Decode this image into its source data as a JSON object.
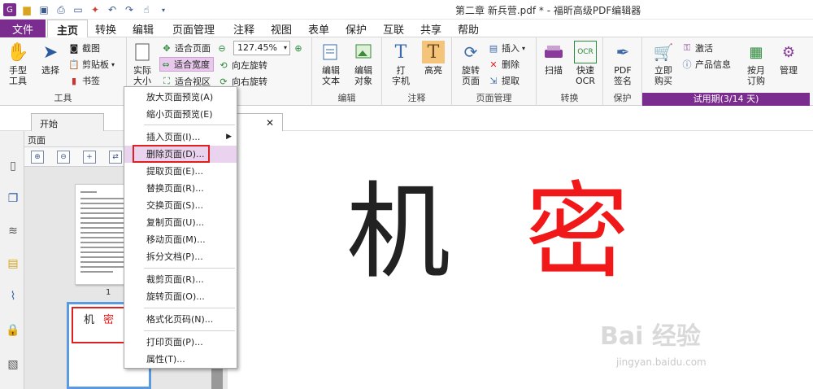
{
  "title": "第二章 新兵营.pdf * - 福昕高级PDF编辑器",
  "menu_tabs": [
    "文件",
    "主页",
    "转换",
    "编辑",
    "页面管理",
    "注释",
    "视图",
    "表单",
    "保护",
    "互联",
    "共享",
    "帮助"
  ],
  "ribbon": {
    "hand_tool": "手型\n工具",
    "select": "选择",
    "screenshot": "截图",
    "clipboard": "剪贴板",
    "bookmark": "书签",
    "tools_group": "工具",
    "actual_size": "实际\n大小",
    "fit_page": "适合页面",
    "fit_width": "适合宽度",
    "fit_view": "适合视区",
    "zoom": "127.45%",
    "rotate_left": "向左旋转",
    "rotate_right": "向右旋转",
    "edit_text": "编辑\n文本",
    "edit_object": "编辑\n对象",
    "edit_group": "编辑",
    "typewriter": "打\n字机",
    "highlight": "高亮",
    "annot_group": "注释",
    "rotate_page": "旋转\n页面",
    "insert": "插入",
    "delete": "删除",
    "extract": "提取",
    "pages_group": "页面管理",
    "scan": "扫描",
    "quick_ocr": "快速\nOCR",
    "convert_group": "转换",
    "pdf_sign": "PDF\n签名",
    "protect_group": "保护",
    "buy_now": "立即\n购买",
    "activate": "激活",
    "product_info": "产品信息",
    "monthly": "按月\n订购",
    "manage": "管理",
    "trial": "试用期(3/14 天)"
  },
  "doc_tabs": {
    "start": "开始"
  },
  "panel": {
    "title": "页面",
    "page_num": "1",
    "thumb2_text1": "机",
    "thumb2_text2": "密"
  },
  "content": {
    "char1": "机",
    "char2": "密"
  },
  "context_menu": [
    "放大页面预览(A)",
    "缩小页面预览(E)",
    "插入页面(I)...",
    "删除页面(D)...",
    "提取页面(E)...",
    "替换页面(R)...",
    "交换页面(S)...",
    "复制页面(U)...",
    "移动页面(M)...",
    "拆分文档(P)...",
    "裁剪页面(R)...",
    "旋转页面(O)...",
    "格式化页码(N)...",
    "打印页面(P)...",
    "属性(T)..."
  ],
  "watermark": {
    "main": "Bai 经验",
    "sub": "jingyan.baidu.com"
  },
  "colors": {
    "accent": "#7b2c8f",
    "red_char": "#f01818",
    "highlight": "#e02020"
  }
}
